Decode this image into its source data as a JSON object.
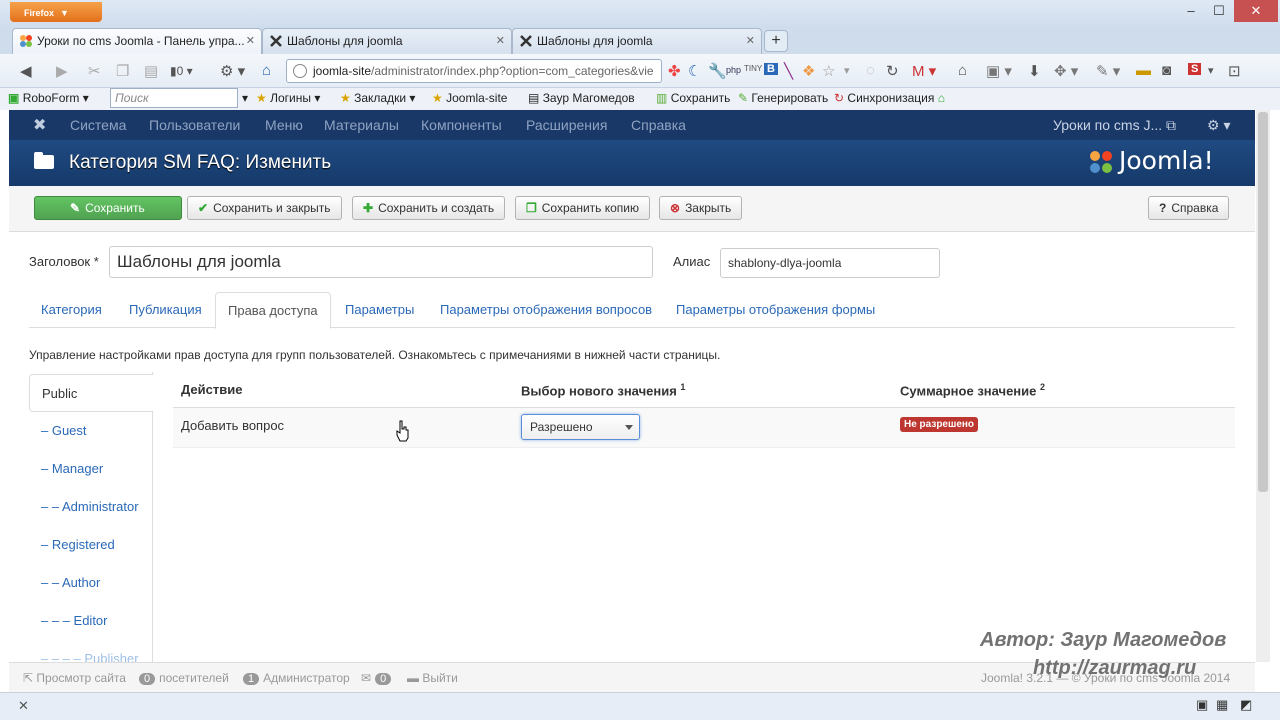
{
  "browser": {
    "menu_button": "Firefox",
    "tabs": [
      {
        "title": "Уроки по cms Joomla - Панель упра...",
        "active": true
      },
      {
        "title": "Шаблоны для joomla",
        "active": false
      },
      {
        "title": "Шаблоны для joomla",
        "active": false
      }
    ],
    "url_host": "joomla-site",
    "url_rest": "/administrator/index.php?option=com_categories&vie",
    "counter": "0",
    "bookmarks": {
      "roboform": "RoboForm",
      "search_placeholder": "Поиск",
      "logins": "Логины",
      "bookmarks": "Закладки",
      "joomla_site": "Joomla-site",
      "author": "Заур Магомедов",
      "save": "Сохранить",
      "generate": "Генерировать",
      "sync": "Синхронизация"
    }
  },
  "joomla": {
    "menu": [
      "Система",
      "Пользователи",
      "Меню",
      "Материалы",
      "Компоненты",
      "Расширения",
      "Справка"
    ],
    "site_name": "Уроки по cms J...",
    "page_title": "Категория SM FAQ: Изменить",
    "logo_text": "Joomla!",
    "toolbar": {
      "save": "Сохранить",
      "save_close": "Сохранить и закрыть",
      "save_new": "Сохранить и создать",
      "save_copy": "Сохранить копию",
      "close": "Закрыть",
      "help": "Справка"
    },
    "form": {
      "title_label": "Заголовок *",
      "title_value": "Шаблоны для joomla",
      "alias_label": "Алиас",
      "alias_value": "shablony-dlya-joomla"
    },
    "tabs": [
      "Категория",
      "Публикация",
      "Права доступа",
      "Параметры",
      "Параметры отображения вопросов",
      "Параметры отображения формы"
    ],
    "permissions_desc": "Управление настройками прав доступа для групп пользователей. Ознакомьтесь с примечаниями в нижней части страницы.",
    "groups": [
      "Public",
      "– Guest",
      "– Manager",
      "– – Administrator",
      "– Registered",
      "– – Author",
      "– – – Editor",
      "– – – – Publisher"
    ],
    "table": {
      "col_action": "Действие",
      "col_new": "Выбор нового значения",
      "col_new_sup": "1",
      "col_calc": "Суммарное значение",
      "col_calc_sup": "2",
      "row_action": "Добавить вопрос",
      "row_select": "Разрешено",
      "row_badge": "Не разрешено"
    },
    "status": {
      "view_site": "Просмотр сайта",
      "visitors_count": "0",
      "visitors": "посетителей",
      "admins_count": "1",
      "admins": "Администратор",
      "messages_count": "0",
      "logout": "Выйти",
      "footer": "Joomla! 3.2.1 — © Уроки по cms Joomla 2014"
    }
  },
  "watermark": {
    "line1": "Автор: Заур Магомедов",
    "line2": "http://zaurmag.ru"
  }
}
